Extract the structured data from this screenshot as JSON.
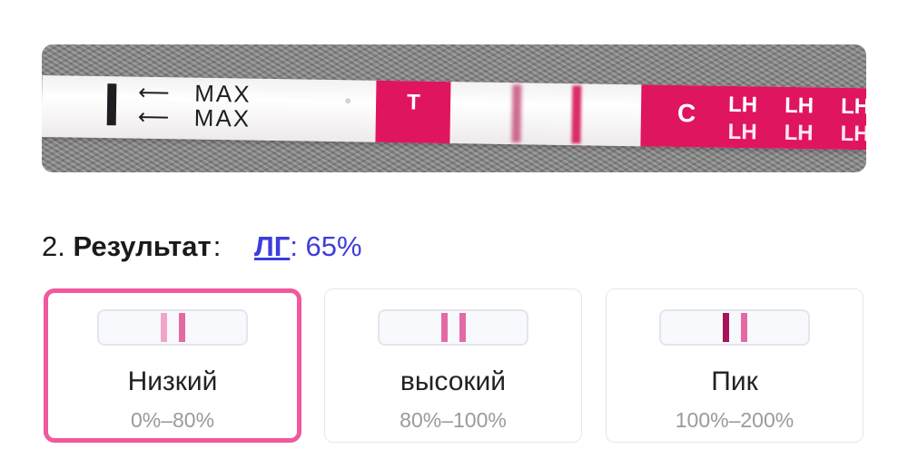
{
  "strip": {
    "max_label_1": "MAX",
    "max_label_2": "MAX",
    "t_label": "T",
    "c_label": "C",
    "lh_labels": [
      "LH",
      "LH",
      "LH"
    ]
  },
  "result": {
    "number": "2.",
    "label": "Результат",
    "lg_link": "ЛГ",
    "lg_value": ": 65%"
  },
  "levels": [
    {
      "name": "Низкий",
      "range": "0%–80%",
      "selected": true,
      "test_line_color": "#f0a5c8",
      "control_line_color": "#e36aa4"
    },
    {
      "name": "высокий",
      "range": "80%–100%",
      "selected": false,
      "test_line_color": "#e36aa4",
      "control_line_color": "#e36aa4"
    },
    {
      "name": "Пик",
      "range": "100%–200%",
      "selected": false,
      "test_line_color": "#a8125a",
      "control_line_color": "#e36aa4"
    }
  ],
  "colors": {
    "accent_pink": "#f0599b",
    "link_blue": "#3d3ddb",
    "strip_pink": "#e0155f"
  }
}
